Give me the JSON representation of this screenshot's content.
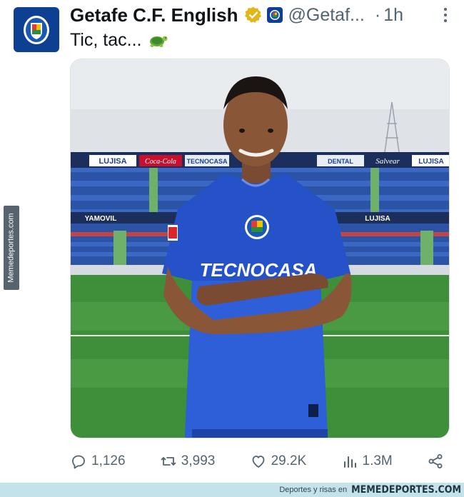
{
  "tweet": {
    "display_name": "Getafe C.F. English",
    "handle": "@Getaf...",
    "separator": "·",
    "time": "1h",
    "text": "Tic, tac...",
    "emoji": "turtle-emoji"
  },
  "media": {
    "alt_subject": "player-photo",
    "boards": [
      "LUJISA",
      "Coca-Cola",
      "TECNOCASA",
      "DENTAL",
      "Salvear",
      "LUJISA"
    ],
    "lower_boards": [
      "YAMOVIL",
      "LUJISA"
    ],
    "shirt_sponsor": "TECNOCASA"
  },
  "stats": {
    "replies": "1,126",
    "reposts": "3,993",
    "likes": "29.2K",
    "views": "1.3M"
  },
  "watermarks": {
    "side": "Memedeportes.com",
    "footer_small": "Deportes y risas en",
    "footer_brand": "MEMEDEPORTES.COM"
  },
  "colors": {
    "brand_blue": "#0d3f93",
    "text_primary": "#0f1419",
    "text_secondary": "#536471",
    "verified_gold": "#e2b719",
    "footer_bg": "#c4e2e9"
  }
}
